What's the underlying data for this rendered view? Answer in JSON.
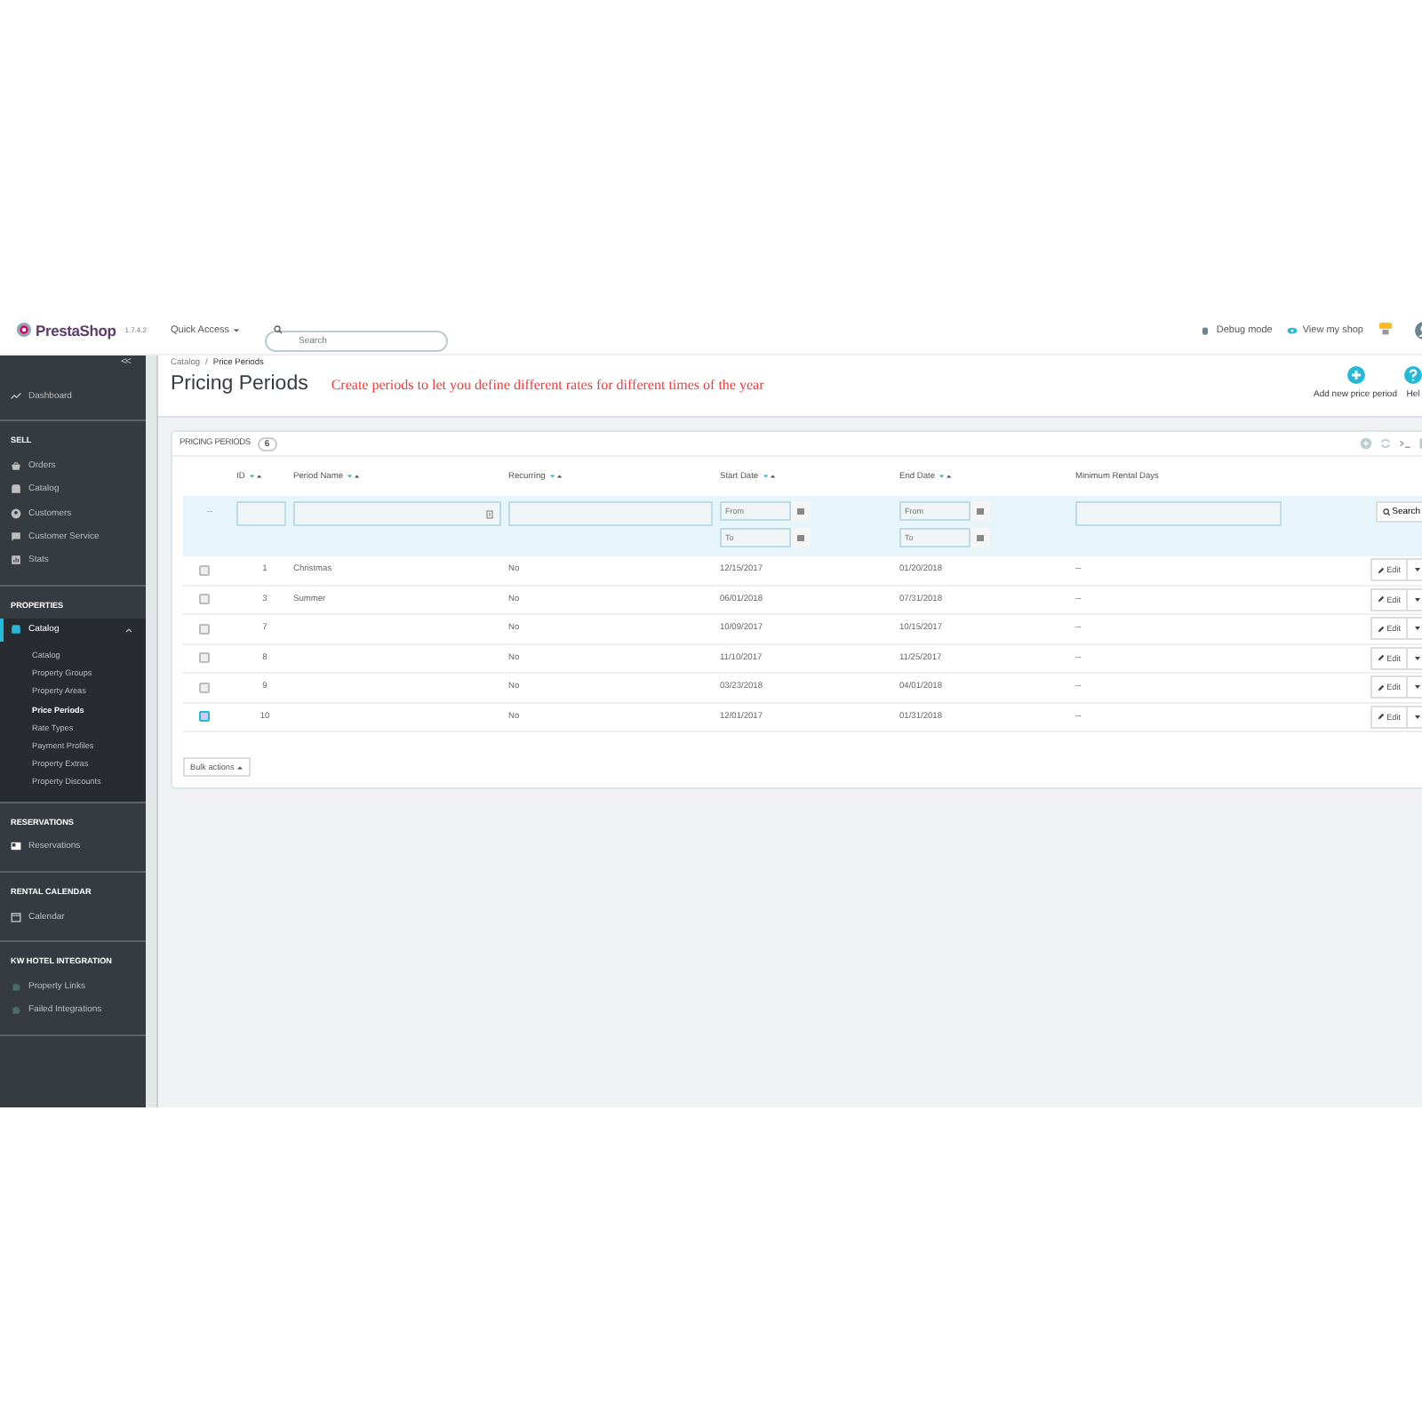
{
  "header": {
    "logo": "PrestaShop",
    "version": "1.7.4.2",
    "quick_access": "Quick Access",
    "search_placeholder": "Search",
    "debug": "Debug mode",
    "view_shop": "View my shop"
  },
  "sidebar": {
    "collapse": "<<",
    "sections": [
      {
        "items": [
          {
            "label": "Dashboard",
            "selected": false,
            "expanded": false
          }
        ]
      },
      {
        "heading": "SELL",
        "items": [
          {
            "label": "Orders",
            "selected": false,
            "expanded": false
          },
          {
            "label": "Catalog",
            "selected": false,
            "expanded": false
          },
          {
            "label": "Customers",
            "selected": false,
            "expanded": false
          },
          {
            "label": "Customer Service",
            "selected": false,
            "expanded": false
          },
          {
            "label": "Stats",
            "selected": false,
            "expanded": false
          }
        ]
      },
      {
        "heading": "PROPERTIES",
        "items": [
          {
            "label": "Catalog",
            "selected": true,
            "expanded": true,
            "children": [
              {
                "label": "Catalog",
                "selected": false
              },
              {
                "label": "Property Groups",
                "selected": false
              },
              {
                "label": "Property Areas",
                "selected": false
              },
              {
                "label": "Price Periods",
                "selected": true
              },
              {
                "label": "Rate Types",
                "selected": false
              },
              {
                "label": "Payment Profiles",
                "selected": false
              },
              {
                "label": "Property Extras",
                "selected": false
              },
              {
                "label": "Property Discounts",
                "selected": false
              }
            ]
          }
        ]
      },
      {
        "heading": "RESERVATIONS",
        "items": [
          {
            "label": "Reservations",
            "selected": false,
            "expanded": false
          }
        ]
      },
      {
        "heading": "RENTAL CALENDAR",
        "items": [
          {
            "label": "Calendar",
            "selected": false,
            "expanded": false
          }
        ]
      },
      {
        "heading": "KW HOTEL INTEGRATION",
        "items": [
          {
            "label": "Property Links",
            "selected": false,
            "expanded": false
          },
          {
            "label": "Failed Integrations",
            "selected": false,
            "expanded": false
          }
        ]
      }
    ]
  },
  "page": {
    "breadcrumb": [
      "Catalog",
      "Price Periods"
    ],
    "breadcrumb_separator": "/",
    "title": "Pricing Periods",
    "note": "Create periods to let you define different rates for different times of the year",
    "toolbar": [
      {
        "kind": "add",
        "label": "Add new price period"
      },
      {
        "kind": "help",
        "label": "Hel"
      }
    ]
  },
  "panel": {
    "title": "PRICING PERIODS",
    "count": "6",
    "columns": [
      {
        "label": "ID",
        "sortable": true,
        "kind": "text"
      },
      {
        "label": "Period Name",
        "sortable": true,
        "kind": "text"
      },
      {
        "label": "Recurring",
        "sortable": true,
        "kind": "text"
      },
      {
        "label": "Start Date",
        "sortable": true,
        "kind": "date",
        "placeholders": [
          "From",
          "To"
        ]
      },
      {
        "label": "End Date",
        "sortable": true,
        "kind": "date",
        "placeholders": [
          "From",
          "To"
        ]
      },
      {
        "label": "Minimum Rental Days",
        "sortable": false,
        "kind": "text"
      }
    ],
    "search": "Search",
    "select_all": "--",
    "rows": [
      {
        "selected": false,
        "cells": [
          "1",
          "Christmas",
          "No",
          "12/15/2017",
          "01/20/2018",
          "--"
        ],
        "edit": "Edit"
      },
      {
        "selected": false,
        "cells": [
          "3",
          "Summer",
          "No",
          "06/01/2018",
          "07/31/2018",
          "--"
        ],
        "edit": "Edit"
      },
      {
        "selected": false,
        "cells": [
          "7",
          "",
          "No",
          "10/09/2017",
          "10/15/2017",
          "--"
        ],
        "edit": "Edit"
      },
      {
        "selected": false,
        "cells": [
          "8",
          "",
          "No",
          "11/10/2017",
          "11/25/2017",
          "--"
        ],
        "edit": "Edit"
      },
      {
        "selected": false,
        "cells": [
          "9",
          "",
          "No",
          "03/23/2018",
          "04/01/2018",
          "--"
        ],
        "edit": "Edit"
      },
      {
        "selected": true,
        "cells": [
          "10",
          "",
          "No",
          "12/01/2017",
          "01/31/2018",
          "--"
        ],
        "edit": "Edit"
      }
    ],
    "bulk": "Bulk actions"
  }
}
